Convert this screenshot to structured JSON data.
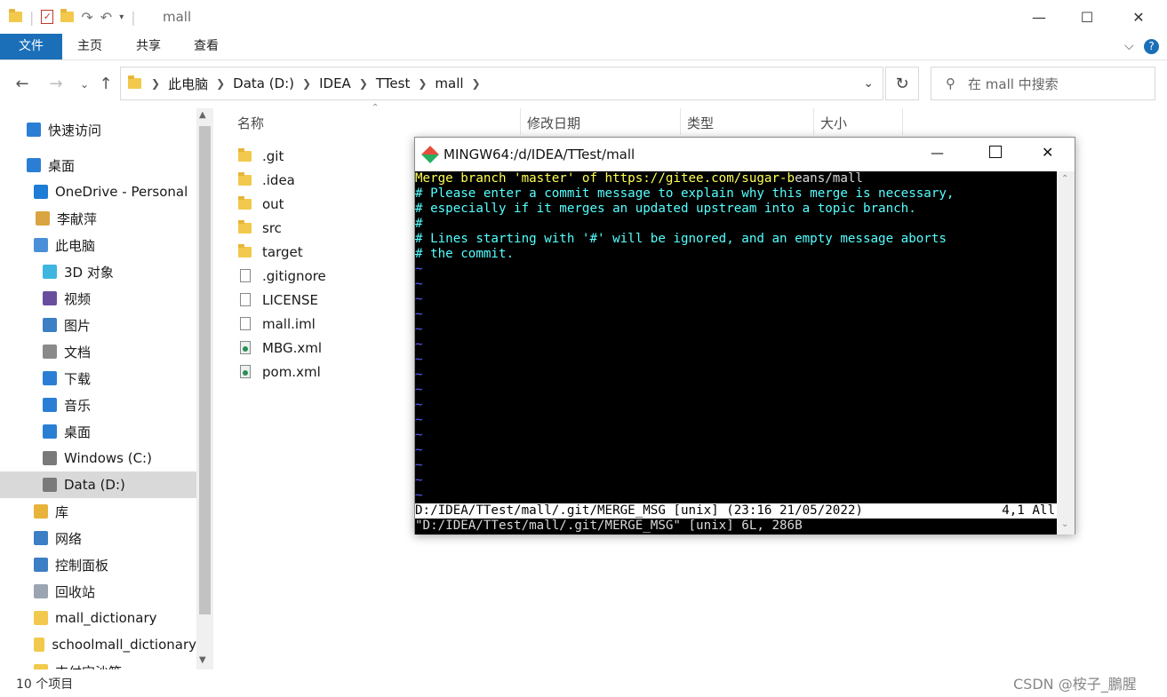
{
  "window": {
    "title": "mall",
    "controls": {
      "minimize": "—",
      "maximize": "☐",
      "close": "✕"
    }
  },
  "ribbon": {
    "tabs": [
      "文件",
      "主页",
      "共享",
      "查看"
    ]
  },
  "address": {
    "crumbs": [
      "此电脑",
      "Data (D:)",
      "IDEA",
      "TTest",
      "mall"
    ],
    "search_placeholder": "在 mall 中搜索"
  },
  "sidebar": {
    "items": [
      {
        "label": "快速访问",
        "icon": "star-icon",
        "color": "#2a7fd4"
      },
      {
        "label": "桌面",
        "icon": "desktop-icon",
        "color": "#2a7fd4"
      },
      {
        "label": "OneDrive - Personal",
        "icon": "cloud-icon",
        "color": "#1e7bd6"
      },
      {
        "label": "李献萍",
        "icon": "user-icon",
        "color": "#d9a441"
      },
      {
        "label": "此电脑",
        "icon": "computer-icon",
        "color": "#4a90d9"
      },
      {
        "label": "3D 对象",
        "icon": "cube-icon",
        "color": "#3fb6e0"
      },
      {
        "label": "视频",
        "icon": "video-icon",
        "color": "#6a4e9e"
      },
      {
        "label": "图片",
        "icon": "pictures-icon",
        "color": "#3c7fc4"
      },
      {
        "label": "文档",
        "icon": "documents-icon",
        "color": "#8a8a8a"
      },
      {
        "label": "下载",
        "icon": "download-icon",
        "color": "#2a7fd4"
      },
      {
        "label": "音乐",
        "icon": "music-icon",
        "color": "#2a7fd4"
      },
      {
        "label": "桌面",
        "icon": "desktop-icon",
        "color": "#2a7fd4"
      },
      {
        "label": "Windows (C:)",
        "icon": "drive-icon",
        "color": "#7a7a7a"
      },
      {
        "label": "Data (D:)",
        "icon": "drive-icon",
        "color": "#7a7a7a"
      },
      {
        "label": "库",
        "icon": "library-icon",
        "color": "#e8b33a"
      },
      {
        "label": "网络",
        "icon": "network-icon",
        "color": "#3c7fc4"
      },
      {
        "label": "控制面板",
        "icon": "control-panel-icon",
        "color": "#3c7fc4"
      },
      {
        "label": "回收站",
        "icon": "recycle-bin-icon",
        "color": "#9aa5b1"
      },
      {
        "label": "mall_dictionary",
        "icon": "folder-icon",
        "color": "#f2c94c"
      },
      {
        "label": "schoolmall_dictionary",
        "icon": "folder-icon",
        "color": "#f2c94c"
      },
      {
        "label": "支付宝沙箱",
        "icon": "folder-icon",
        "color": "#f2c94c"
      }
    ]
  },
  "filelist": {
    "columns": [
      "名称",
      "修改日期",
      "类型",
      "大小"
    ],
    "files": [
      {
        "name": ".git",
        "kind": "folder"
      },
      {
        "name": ".idea",
        "kind": "folder"
      },
      {
        "name": "out",
        "kind": "folder"
      },
      {
        "name": "src",
        "kind": "folder"
      },
      {
        "name": "target",
        "kind": "folder"
      },
      {
        "name": ".gitignore",
        "kind": "doc"
      },
      {
        "name": "LICENSE",
        "kind": "doc"
      },
      {
        "name": "mall.iml",
        "kind": "doc"
      },
      {
        "name": "MBG.xml",
        "kind": "xml"
      },
      {
        "name": "pom.xml",
        "kind": "xml"
      }
    ]
  },
  "status": {
    "count": "10 个项目",
    "watermark": "CSDN @桉子_鵬腥"
  },
  "terminal": {
    "title": "MINGW64:/d/IDEA/TTest/mall",
    "line1_yellow": "Merge branch 'master' of https://gitee.com/sugar-b",
    "line1_white": "eans/mall",
    "comments": [
      "# Please enter a commit message to explain why this merge is necessary,",
      "# especially if it merges an updated upstream into a topic branch.",
      "#",
      "# Lines starting with '#' will be ignored, and an empty message aborts",
      "# the commit."
    ],
    "tilde": "~",
    "tilde_count": 16,
    "status_left": "D:/IDEA/TTest/mall/.git/MERGE_MSG [unix] (23:16 21/05/2022)",
    "status_right": "4,1 All",
    "message": "\"D:/IDEA/TTest/mall/.git/MERGE_MSG\" [unix] 6L, 286B"
  }
}
